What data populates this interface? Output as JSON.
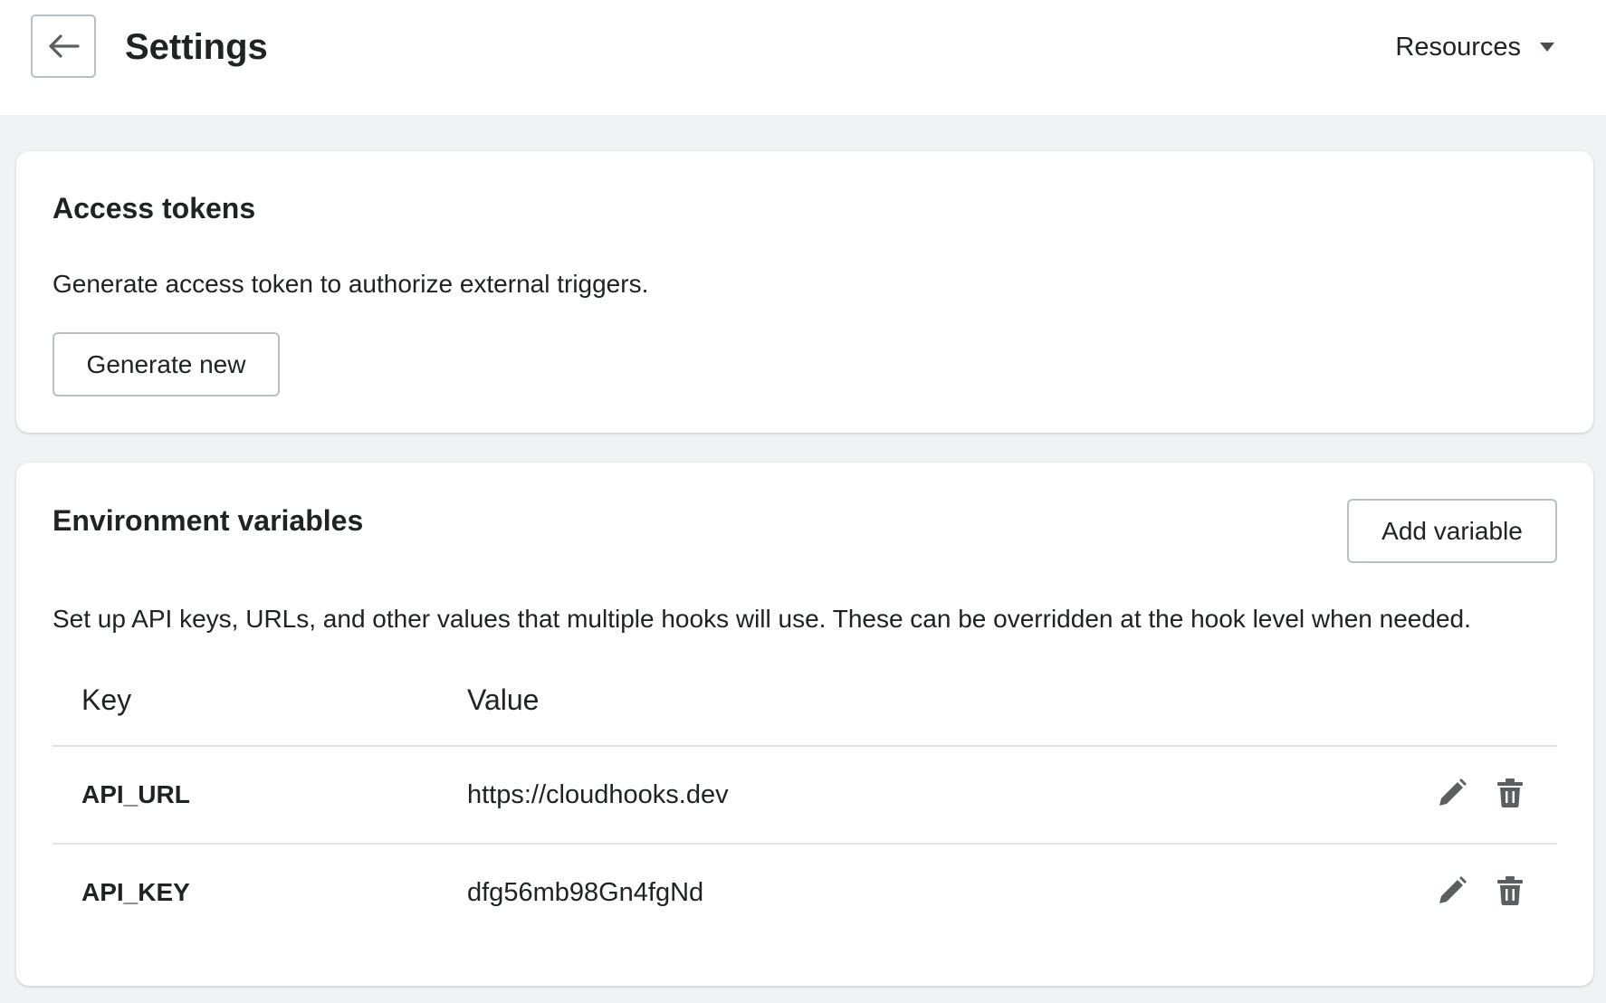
{
  "header": {
    "title": "Settings",
    "resources_label": "Resources"
  },
  "access_tokens": {
    "title": "Access tokens",
    "description": "Generate access token to authorize external triggers.",
    "generate_label": "Generate new"
  },
  "env_vars": {
    "title": "Environment variables",
    "add_label": "Add variable",
    "description": "Set up API keys, URLs, and other values that multiple hooks will use. These can be overridden at the hook level when needed.",
    "columns": [
      "Key",
      "Value"
    ],
    "rows": [
      {
        "key": "API_URL",
        "value": "https://cloudhooks.dev"
      },
      {
        "key": "API_KEY",
        "value": "dfg56mb98Gn4fgNd"
      }
    ]
  },
  "icons": {
    "back": "arrow-left-icon",
    "resources_caret": "caret-down-icon",
    "edit": "pencil-icon",
    "delete": "trash-icon"
  },
  "colors": {
    "background": "#f1f2f4",
    "text": "#202223",
    "border": "#babfc3",
    "icon": "#5c5f62"
  }
}
